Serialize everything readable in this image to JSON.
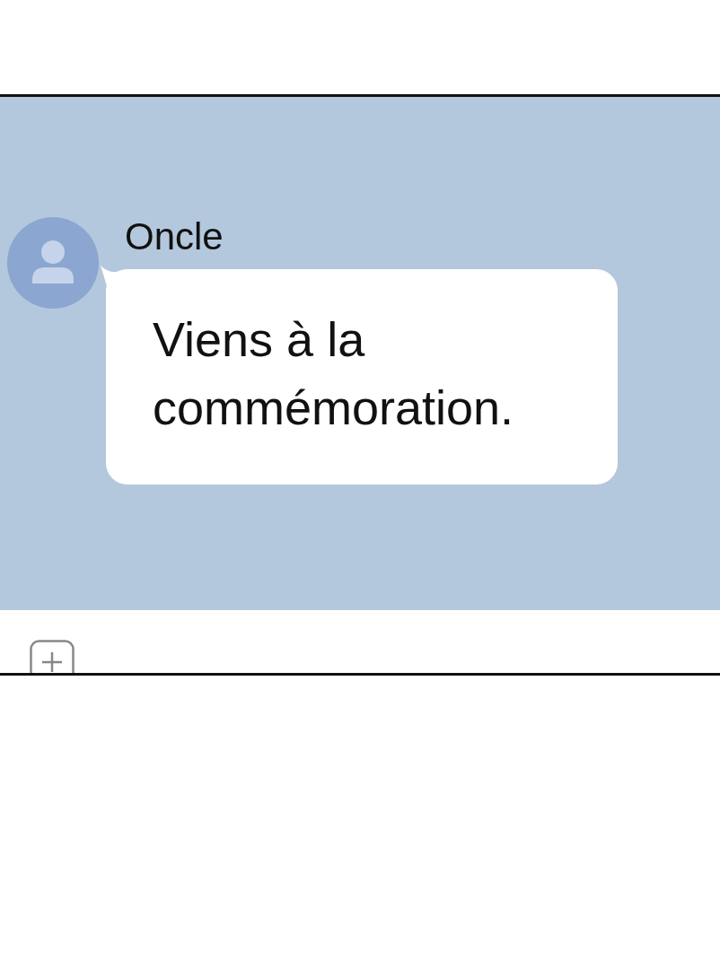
{
  "messages": [
    {
      "sender": "Oncle",
      "text": "Viens à la commémoration."
    }
  ]
}
